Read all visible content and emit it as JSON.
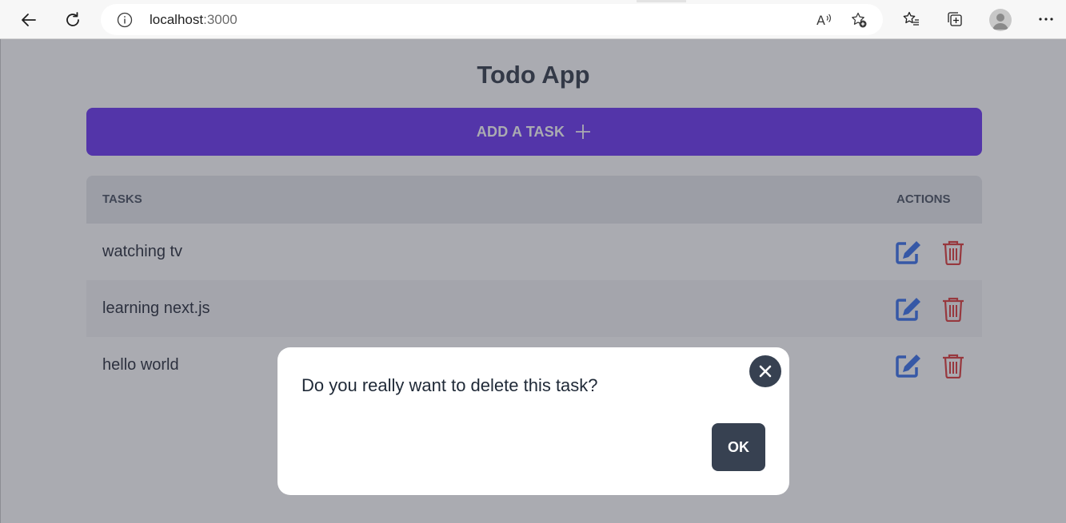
{
  "browser": {
    "url_host": "localhost",
    "url_port": ":3000",
    "icons": [
      "back-arrow-icon",
      "refresh-icon",
      "info-icon",
      "read-aloud-icon",
      "add-favorite-icon",
      "favorites-icon",
      "collections-icon",
      "profile-avatar",
      "more-icon"
    ]
  },
  "app": {
    "title": "Todo App",
    "add_button_label": "ADD A TASK",
    "accent_color": "#5b21f0"
  },
  "table": {
    "headers": {
      "tasks": "TASKS",
      "actions": "ACTIONS"
    },
    "rows": [
      {
        "task": "watching tv"
      },
      {
        "task": "learning next.js"
      },
      {
        "task": "hello world"
      }
    ]
  },
  "modal": {
    "message": "Do you really want to delete this task?",
    "ok_label": "OK"
  }
}
